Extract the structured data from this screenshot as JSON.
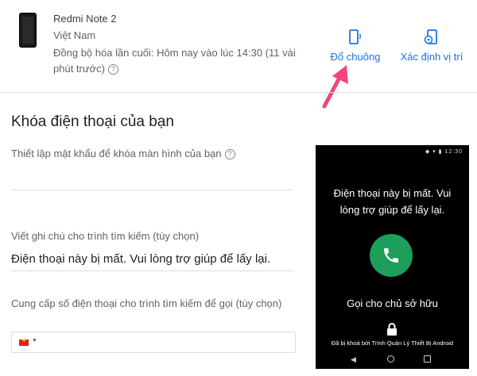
{
  "device": {
    "name": "Redmi Note 2",
    "country": "Việt Nam",
    "last_sync": "Đồng bộ hóa lần cuối: Hôm nay vào lúc 14:30 (11 vài phút trước)",
    "help_glyph": "?"
  },
  "actions": {
    "ring_label": "Đổ chuông",
    "locate_label": "Xác định vị trí",
    "accent_color": "#1a73e8"
  },
  "annotation": {
    "arrow_color": "#f0487a"
  },
  "lock_section": {
    "title": "Khóa điện thoại của bạn",
    "password_label": "Thiết lập mật khẩu để khóa màn hình của bạn",
    "password_value": "",
    "note_label": "Viết ghi chú cho trình tìm kiếm (tùy chọn)",
    "note_value": "Điện thoại này bị mất. Vui lòng trợ giúp để lấy lại.",
    "phone_label": "Cung cấp số điện thoại cho trình tìm kiếm để gọi (tùy chọn)",
    "phone_value": "",
    "country_flag": "vietnam-flag-icon"
  },
  "preview": {
    "status_time": "12:30",
    "message": "Điện thoại này bị mất. Vui lòng trợ giúp để lấy lại.",
    "call_owner": "Gọi cho chủ sở hữu",
    "locked_by": "Đã bị khoá bởi Trình Quản Lý Thiết Bị Android",
    "call_color": "#1e9e5b"
  }
}
